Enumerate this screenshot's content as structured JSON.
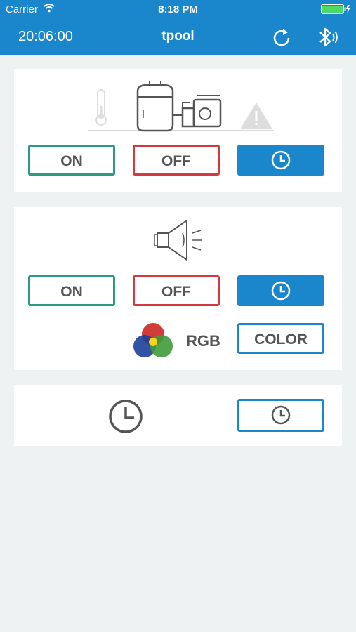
{
  "status_bar": {
    "carrier": "Carrier",
    "time": "8:18 PM"
  },
  "nav_bar": {
    "clock": "20:06:00",
    "title": "tpool",
    "refresh_icon": "refresh-icon",
    "bluetooth_icon": "bluetooth-icon"
  },
  "pump_card": {
    "on_label": "ON",
    "off_label": "OFF",
    "timer_icon": "clock-icon"
  },
  "light_card": {
    "on_label": "ON",
    "off_label": "OFF",
    "timer_icon": "clock-icon",
    "rgb_label": "RGB",
    "color_label": "COLOR"
  },
  "schedule_card": {
    "icon": "clock-icon",
    "timer_icon": "clock-icon"
  },
  "colors": {
    "primary": "#1a86cc",
    "on": "#2a9a84",
    "off": "#d23a3f",
    "background": "#eef2f3"
  }
}
